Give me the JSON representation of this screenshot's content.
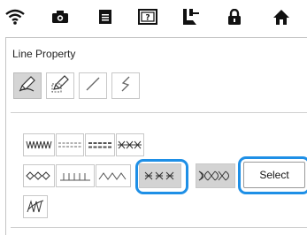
{
  "topbar": {
    "icons": [
      "wifi-icon",
      "camera-icon",
      "document-icon",
      "help-icon",
      "embroidery-foot-icon",
      "lock-icon",
      "home-icon"
    ]
  },
  "line_property": {
    "title": "Line Property",
    "tools": [
      "pen-region-icon",
      "pen-outline-icon",
      "straight-line-icon",
      "zigzag-line-icon"
    ],
    "selected_tool_index": 0
  },
  "stitches": {
    "items": [
      "zigzag-stitch",
      "running-stitch",
      "triple-stitch",
      "cross-stitch",
      "diamond-stitch",
      "blanket-stitch",
      "wave-stitch",
      "feather-stitch",
      "decorative-stitch",
      "candlewick-stitch"
    ],
    "selected_item": "feather-stitch",
    "select_label": "Select"
  },
  "colors": {
    "highlight": "#1e8fe6",
    "selected_bg": "#d3d3d3"
  }
}
